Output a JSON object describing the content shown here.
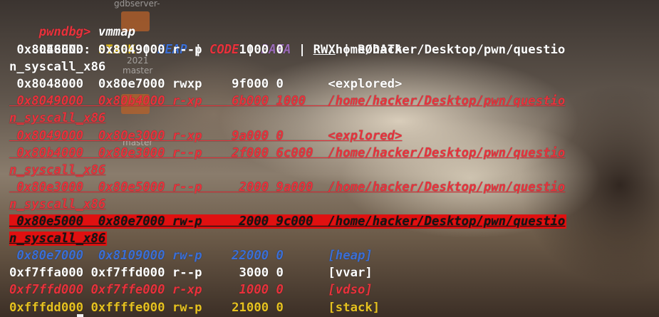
{
  "command": {
    "prompt": "pwndbg>",
    "text": " vmmap"
  },
  "legend": {
    "label": "LEGEND: ",
    "stack": "STACK",
    "heap": "HEAP",
    "code": "CODE",
    "data": "DATA",
    "rwx": "RWX",
    "rodata": "RODATA",
    "sep": " | "
  },
  "rows": [
    {
      "text": " 0x8048000  0x8049000 r--p     1000 0      /home/hacker/Desktop/pwn/questio",
      "style": "c-white"
    },
    {
      "text": "n_syscall_x86",
      "style": "c-white"
    },
    {
      "text": " 0x8048000  0x80e7000 rwxp    9f000 0      <explored>",
      "style": "c-white"
    },
    {
      "text": " 0x8049000  0x80b4000 r-xp    6b000 1000   /home/hacker/Desktop/pwn/questio",
      "style": "row-code"
    },
    {
      "text": "n_syscall_x86",
      "style": "row-code"
    },
    {
      "text": " 0x8049000  0x80e3000 r-xp    9a000 0      <explored>",
      "style": "row-code"
    },
    {
      "text": " 0x80b4000  0x80e3000 r--p    2f000 6c000  /home/hacker/Desktop/pwn/questio",
      "style": "row-code"
    },
    {
      "text": "n_syscall_x86",
      "style": "row-code"
    },
    {
      "text": " 0x80e3000  0x80e5000 r--p     2000 9a000  /home/hacker/Desktop/pwn/questio",
      "style": "row-code"
    },
    {
      "text": "n_syscall_x86",
      "style": "row-code"
    },
    {
      "text": " 0x80e5000  0x80e7000 rw-p     2000 9c000  /home/hacker/Desktop/pwn/questio",
      "style": "row-rwx-hl"
    },
    {
      "text": "n_syscall_x86",
      "style": "row-rwx-hl"
    },
    {
      "text": " 0x80e7000  0x8109000 rw-p    22000 0      [heap]",
      "style": "row-heap"
    },
    {
      "text": "0xf7ffa000 0xf7ffd000 r--p     3000 0      [vvar]",
      "style": "c-white"
    },
    {
      "text": "0xf7ffd000 0xf7ffe000 r-xp     1000 0      [vdso]",
      "style": "row-vdso"
    },
    {
      "text": "0xfffdd000 0xffffe000 rw-p    21000 0      [stack]",
      "style": "row-stack"
    }
  ],
  "desktop": {
    "labels": [
      "gdbserver-",
      "master",
      "2021",
      "master",
      "master"
    ]
  },
  "colors": {
    "prompt": "#e8323c",
    "stack": "#e6c220",
    "heap": "#3b6fd6",
    "code": "#e8323c",
    "data": "#9a6ab8",
    "highlight": "#e01010"
  }
}
